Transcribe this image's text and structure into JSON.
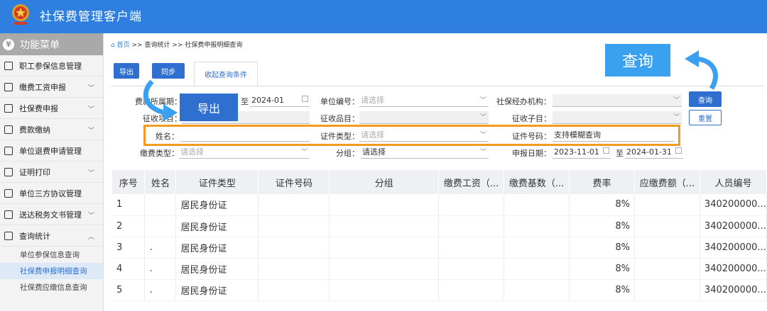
{
  "app": {
    "title": "社保费管理客户端"
  },
  "sidebar": {
    "header": "功能菜单",
    "items": [
      {
        "label": "职工参保信息管理",
        "expandable": false
      },
      {
        "label": "缴费工资申报",
        "expandable": true
      },
      {
        "label": "社保费申报",
        "expandable": true
      },
      {
        "label": "费款缴纳",
        "expandable": true
      },
      {
        "label": "单位退费申请管理",
        "expandable": false
      },
      {
        "label": "证明打印",
        "expandable": true
      },
      {
        "label": "单位三方协议管理",
        "expandable": false
      },
      {
        "label": "送达税务文书管理",
        "expandable": true
      },
      {
        "label": "查询统计",
        "expandable": true,
        "expanded": true
      }
    ],
    "sub_items": [
      {
        "label": "单位参保信息查询",
        "active": false
      },
      {
        "label": "社保费申报明细查询",
        "active": true
      },
      {
        "label": "社保费应缴信息查询",
        "active": false
      }
    ]
  },
  "breadcrumb": {
    "home": "首页",
    "sep": ">>",
    "level1": "查询统计",
    "level2": "社保费申报明细查询"
  },
  "toolbar": {
    "export": "导出",
    "sync": "同步",
    "collapse_tab": "收起查询条件"
  },
  "form": {
    "fee_period_label": "费款所属期：",
    "fee_period_to": "至",
    "fee_period_end": "2024-01",
    "unit_code_label": "单位编号：",
    "unit_code_placeholder": "请选择",
    "agency_label": "社保经办机构：",
    "item_label": "征收项目：",
    "product_label": "征收品目：",
    "subitem_label": "征收子目：",
    "name_label": "姓名：",
    "id_type_label": "证件类型：",
    "id_type_placeholder": "请选择",
    "id_no_label": "证件号码：",
    "id_no_value": "支持模糊查询",
    "pay_type_label": "缴费类型：",
    "pay_type_placeholder": "请选择",
    "group_label": "分组：",
    "group_value": "请选择",
    "report_date_label": "申报日期：",
    "report_date_from": "2023-11-01",
    "report_date_to_sep": "至",
    "report_date_to": "2024-01-31",
    "query_btn": "查询",
    "reset_btn": "重置"
  },
  "annotations": {
    "query_callout": "查询",
    "export_callout": "导出"
  },
  "table": {
    "columns": [
      "序号",
      "姓名",
      "证件类型",
      "证件号码",
      "分组",
      "缴费工资（...",
      "缴费基数（...",
      "费率",
      "应缴费额（...",
      "人员编号"
    ],
    "rows": [
      [
        "1",
        "",
        "居民身份证",
        "",
        "",
        "",
        "",
        "8%",
        "",
        "340200000..."
      ],
      [
        "2",
        "",
        "居民身份证",
        "",
        "",
        "",
        "",
        "8%",
        "",
        "340200000..."
      ],
      [
        "3",
        ".",
        "居民身份证",
        "",
        "",
        "",
        "",
        "8%",
        "",
        "340200000..."
      ],
      [
        "4",
        ".",
        "居民身份证",
        "",
        "",
        "",
        "",
        "8%",
        "",
        "340200000..."
      ],
      [
        "5",
        ".",
        "居民身份证",
        "",
        "",
        "",
        "",
        "8%",
        "",
        "340200000..."
      ]
    ]
  },
  "colors": {
    "primary": "#2e6fd0",
    "topbar": "#2e7fe0",
    "highlight": "#f39a22",
    "callout": "#3aa0f0"
  }
}
